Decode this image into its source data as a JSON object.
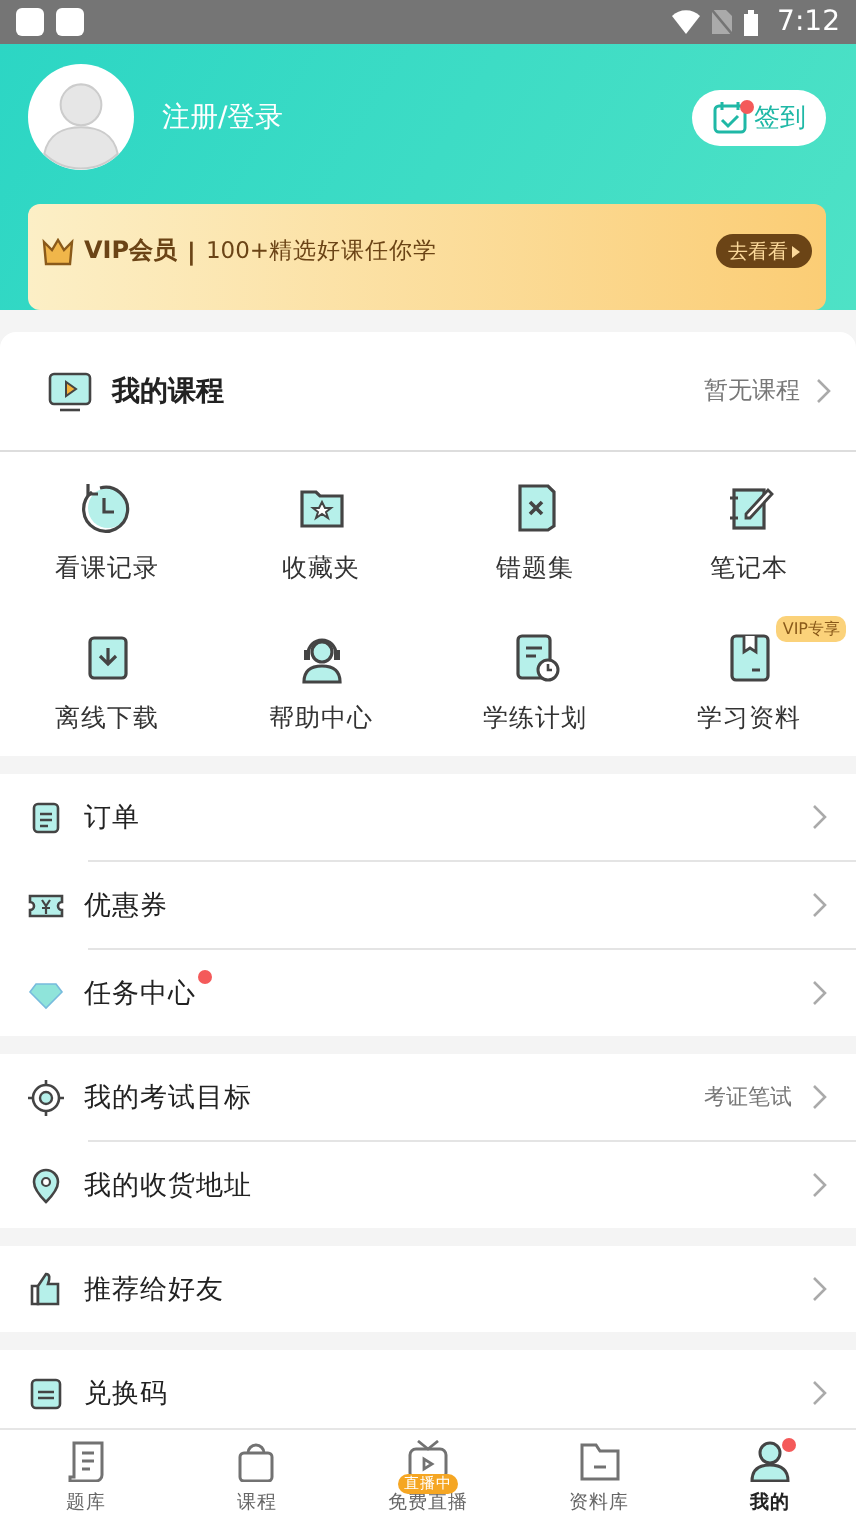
{
  "status_bar": {
    "time": "7:12"
  },
  "header": {
    "login": "注册/登录",
    "checkin": {
      "label": "签到",
      "dot": true
    }
  },
  "vip_banner": {
    "title": "VIP会员",
    "separator": "|",
    "text": "100+精选好课任你学",
    "button": "去看看"
  },
  "my_courses": {
    "title": "我的课程",
    "value": "暂无课程"
  },
  "tools": [
    {
      "label": "看课记录"
    },
    {
      "label": "收藏夹"
    },
    {
      "label": "错题集"
    },
    {
      "label": "笔记本"
    },
    {
      "label": "离线下载"
    },
    {
      "label": "帮助中心"
    },
    {
      "label": "学练计划"
    },
    {
      "label": "学习资料",
      "badge": "VIP专享"
    }
  ],
  "menu_groups": [
    [
      {
        "label": "订单",
        "dot": false
      },
      {
        "label": "优惠券",
        "dot": false
      },
      {
        "label": "任务中心",
        "dot": true
      }
    ],
    [
      {
        "label": "我的考试目标",
        "value": "考证笔试",
        "dot": false
      },
      {
        "label": "我的收货地址",
        "dot": false
      }
    ],
    [
      {
        "label": "推荐给好友",
        "dot": false
      }
    ],
    [
      {
        "label": "兑换码",
        "dot": false
      }
    ]
  ],
  "tab_bar": [
    {
      "label": "题库",
      "selected": false
    },
    {
      "label": "课程",
      "selected": false
    },
    {
      "label": "免费直播",
      "selected": false,
      "badge": "直播中"
    },
    {
      "label": "资料库",
      "selected": false
    },
    {
      "label": "我的",
      "selected": true,
      "dot": true
    }
  ]
}
